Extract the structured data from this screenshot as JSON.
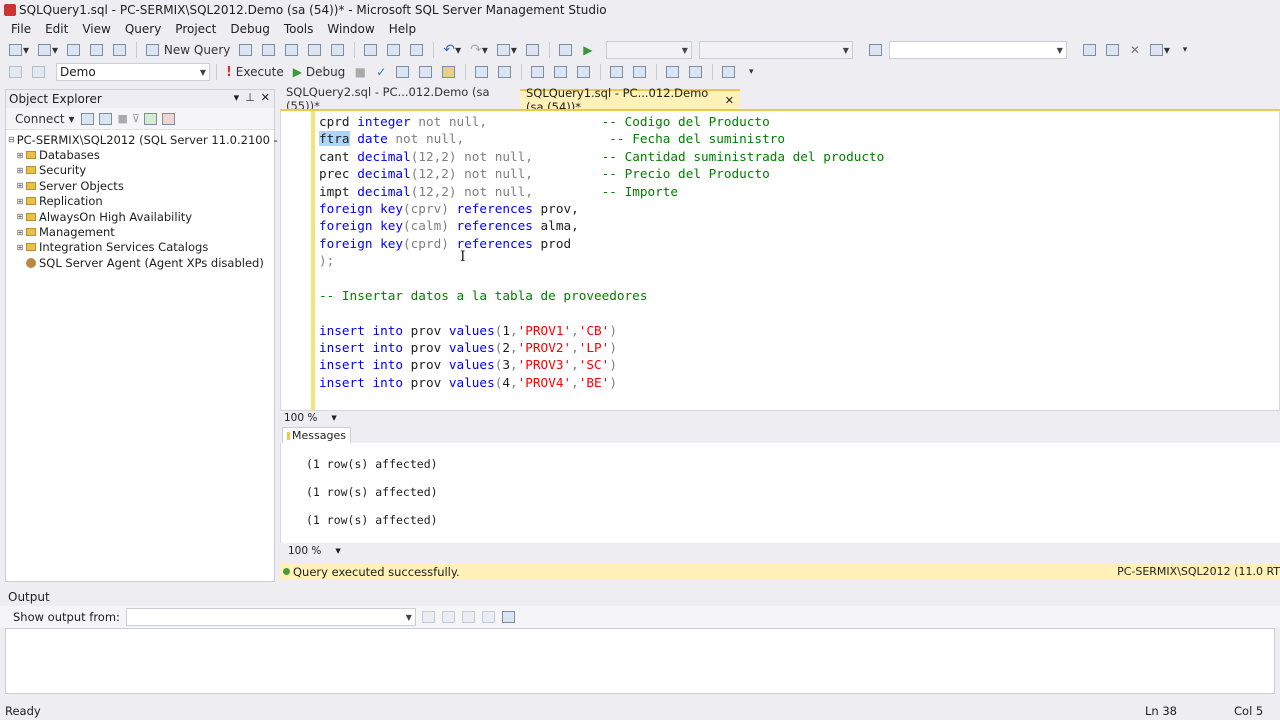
{
  "window": {
    "title": "SQLQuery1.sql - PC-SERMIX\\SQL2012.Demo (sa (54))* - Microsoft SQL Server Management Studio"
  },
  "menu": [
    "File",
    "Edit",
    "View",
    "Query",
    "Project",
    "Debug",
    "Tools",
    "Window",
    "Help"
  ],
  "toolbar": {
    "new_query_label": "New Query",
    "execute_label": "Execute",
    "debug_label": "Debug",
    "database_selected": "Demo"
  },
  "object_explorer": {
    "title": "Object Explorer",
    "connect_label": "Connect",
    "server_node": "PC-SERMIX\\SQL2012 (SQL Server 11.0.2100 - sa)",
    "nodes": [
      "Databases",
      "Security",
      "Server Objects",
      "Replication",
      "AlwaysOn High Availability",
      "Management",
      "Integration Services Catalogs"
    ],
    "agent_node": "SQL Server Agent (Agent XPs disabled)"
  },
  "tabs": {
    "query2": "SQLQuery2.sql - PC...012.Demo (sa (55))*",
    "query1": "SQLQuery1.sql - PC...012.Demo (sa (54))*"
  },
  "editor": {
    "lines": [
      {
        "a": "cprd ",
        "b": "integer",
        "c": " not null,",
        "pad": "               ",
        "cm": "-- Codigo del Producto"
      },
      {
        "sel": "ftra",
        "b2": " date",
        "c": " not null,",
        "pad": "                   ",
        "cm": "-- Fecha del suministro"
      },
      {
        "a": "cant ",
        "b": "decimal",
        "p": "(12,2)",
        "c": " not null,",
        "pad": "         ",
        "cm": "-- Cantidad suministrada del producto"
      },
      {
        "a": "prec ",
        "b": "decimal",
        "p": "(12,2)",
        "c": " not null,",
        "pad": "         ",
        "cm": "-- Precio del Producto"
      },
      {
        "a": "impt ",
        "b": "decimal",
        "p": "(12,2)",
        "c": " not null,",
        "pad": "         ",
        "cm": "-- Importe"
      }
    ],
    "fk": [
      {
        "k": "foreign key",
        "col": "(cprv)",
        "ref": " references",
        "tbl": " prov,"
      },
      {
        "k": "foreign key",
        "col": "(calm)",
        "ref": " references",
        "tbl": " alma,"
      },
      {
        "k": "foreign key",
        "col": "(cprd)",
        "ref": " references",
        "tbl": " prod"
      }
    ],
    "close_line": ");",
    "comment_line": "-- Insertar datos a la tabla de proveedores",
    "inserts": [
      {
        "n": "1",
        "s1": "'PROV1'",
        "s2": "'CB'"
      },
      {
        "n": "2",
        "s1": "'PROV2'",
        "s2": "'LP'"
      },
      {
        "n": "3",
        "s1": "'PROV3'",
        "s2": "'SC'"
      },
      {
        "n": "4",
        "s1": "'PROV4'",
        "s2": "'BE'"
      }
    ],
    "insert_kw": "insert into",
    "insert_tbl": " prov ",
    "values_kw": "values"
  },
  "zoom": {
    "editor": "100 %",
    "messages": "100 %"
  },
  "messages": {
    "tab_label": "Messages",
    "rows": [
      "(1 row(s) affected)",
      "(1 row(s) affected)",
      "(1 row(s) affected)"
    ]
  },
  "query_status": {
    "message": "Query executed successfully.",
    "server": "PC-SERMIX\\SQL2012 (11.0 RT"
  },
  "output": {
    "title": "Output",
    "show_from_label": "Show output from:"
  },
  "statusbar": {
    "state": "Ready",
    "line": "Ln 38",
    "col": "Col 5"
  }
}
